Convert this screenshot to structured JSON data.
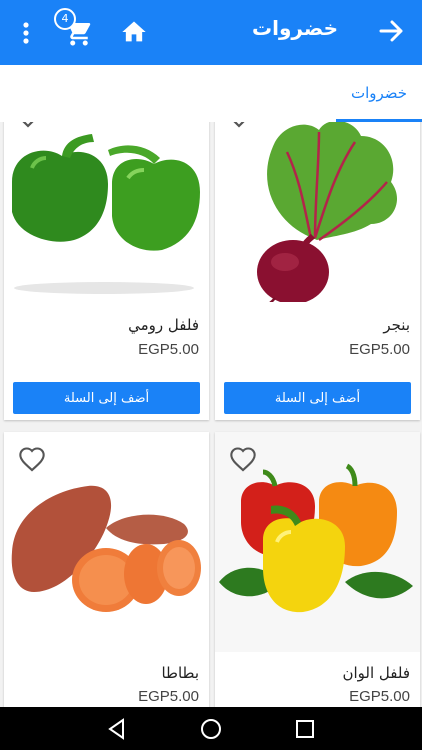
{
  "header": {
    "title": "خضروات",
    "cart_count": "4",
    "icons": [
      "back-arrow-icon",
      "home-icon",
      "cart-icon",
      "more-vert-icon"
    ]
  },
  "tabs": [
    {
      "label": "خضروات",
      "selected": true
    }
  ],
  "products": [
    {
      "name": "بنجر",
      "price": "EGP5.00",
      "add_label": "أضف إلى السلة",
      "image": "beetroot"
    },
    {
      "name": "فلفل رومي",
      "price": "EGP5.00",
      "add_label": "أضف إلى السلة",
      "image": "green-bell-peppers"
    },
    {
      "name": "فلفل الوان",
      "price": "EGP5.00",
      "image": "colored-bell-peppers"
    },
    {
      "name": "بطاطا",
      "price": "EGP5.00",
      "image": "sweet-potatoes"
    }
  ],
  "nav": {
    "icons": [
      "back-triangle-icon",
      "home-circle-icon",
      "recents-square-icon"
    ]
  },
  "colors": {
    "primary": "#1a82f7",
    "nav_bar": "#000000",
    "grid_bg": "#f2f2f2"
  }
}
